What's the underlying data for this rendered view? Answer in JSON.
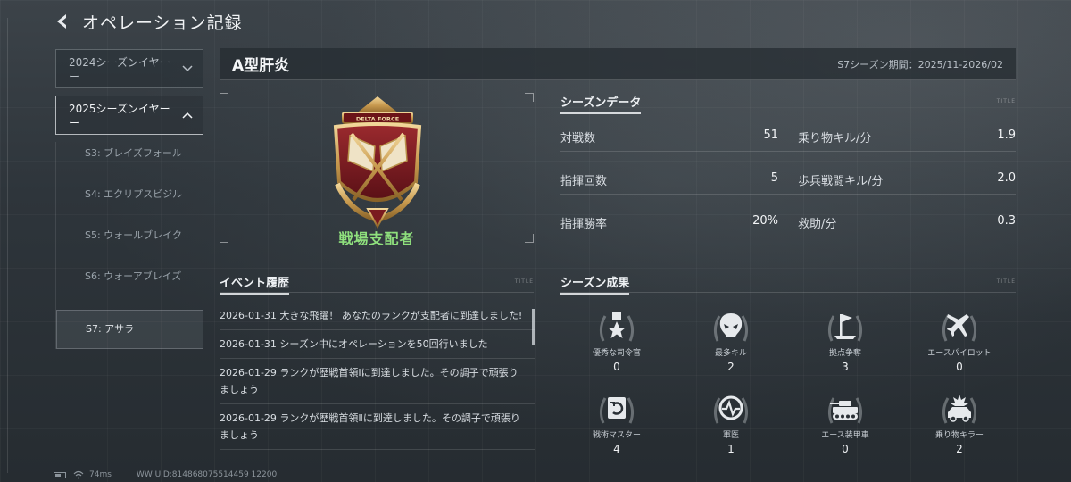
{
  "header": {
    "title": "オペレーション記録"
  },
  "nav": {
    "years": [
      {
        "label": "2024シーズンイヤー",
        "open": false
      },
      {
        "label": "2025シーズンイヤー",
        "open": true
      }
    ],
    "seasons": [
      {
        "label": "S3: ブレイズフォール",
        "active": false
      },
      {
        "label": "S4: エクリプスビジル",
        "active": false
      },
      {
        "label": "S5: ウォールブレイク",
        "active": false
      },
      {
        "label": "S6: ウォーアブレイズ",
        "active": false
      },
      {
        "label": "S7: アサラ",
        "active": true
      }
    ]
  },
  "profile": {
    "name": "A型肝炎",
    "period_label": "S7シーズン期間：2025/11-2026/02",
    "rank": "戦場支配者",
    "badge_text": "DELTA FORCE",
    "colors": {
      "rank": "#8fe07d",
      "badge_red": "#7a1a1f",
      "badge_gold": "#d9b56e"
    }
  },
  "season_data": {
    "title": "シーズンデータ",
    "tag": "TITLE",
    "rows": [
      {
        "left": {
          "label": "対戦数",
          "value": "51"
        },
        "right": {
          "label": "乗り物キル/分",
          "value": "1.9"
        }
      },
      {
        "left": {
          "label": "指揮回数",
          "value": "5"
        },
        "right": {
          "label": "歩兵戦闘キル/分",
          "value": "2.0"
        }
      },
      {
        "left": {
          "label": "指揮勝率",
          "value": "20%"
        },
        "right": {
          "label": "救助/分",
          "value": "0.3"
        }
      }
    ]
  },
  "events": {
    "title": "イベント履歴",
    "tag": "TITLE",
    "items": [
      "2026-01-31 大きな飛躍！ あなたのランクが支配者に到達しました!",
      "2026-01-31 シーズン中にオペレーションを50回行いました",
      "2026-01-29 ランクが歴戦首領Ⅰに到達しました。その調子で頑張りましょう",
      "2026-01-29 ランクが歴戦首領Ⅱに到達しました。その調子で頑張りましょう"
    ]
  },
  "achievements": {
    "title": "シーズン成果",
    "tag": "TITLE",
    "items": [
      {
        "label": "優秀な司令官",
        "value": "0",
        "icon": "star-medal-icon"
      },
      {
        "label": "最多キル",
        "value": "2",
        "icon": "skull-icon"
      },
      {
        "label": "拠点争奪",
        "value": "3",
        "icon": "flag-capture-icon"
      },
      {
        "label": "エースパイロット",
        "value": "0",
        "icon": "jet-icon"
      },
      {
        "label": "戦術マスター",
        "value": "4",
        "icon": "tactics-icon"
      },
      {
        "label": "軍医",
        "value": "1",
        "icon": "medic-pulse-icon"
      },
      {
        "label": "エース装甲車",
        "value": "0",
        "icon": "tank-icon"
      },
      {
        "label": "乗り物キラー",
        "value": "2",
        "icon": "vehicle-explosion-icon"
      }
    ]
  },
  "status": {
    "ping": "74ms",
    "uid": "WW UID:814868075514459 12200"
  }
}
